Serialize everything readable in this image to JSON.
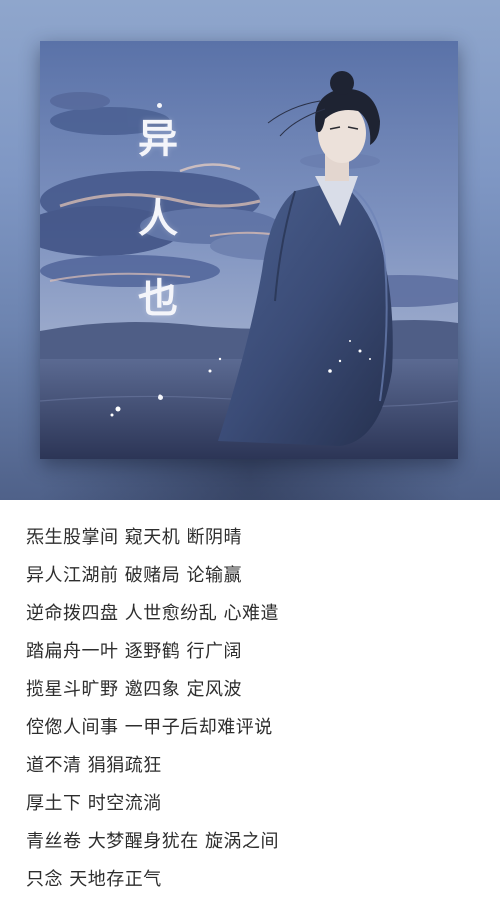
{
  "cover": {
    "title_chars": [
      "异",
      "人",
      "也"
    ]
  },
  "lyrics": [
    "炁生股掌间 窥天机 断阴晴",
    "异人江湖前 破赌局 论输赢",
    "逆命拨四盘 人世愈纷乱 心难遣",
    "踏扁舟一叶 逐野鹤 行广阔",
    "揽星斗旷野 邀四象 定风波",
    "倥偬人间事 一甲子后却难评说",
    "道不清 狷狷疏狂",
    "厚土下 时空流淌",
    "青丝卷 大梦醒身犹在 旋涡之间",
    "只念 天地存正气"
  ],
  "colors": {
    "backdrop": "#7f97c4",
    "lyric_text": "#2e2e2e",
    "title_text": "#f4f5fa"
  }
}
